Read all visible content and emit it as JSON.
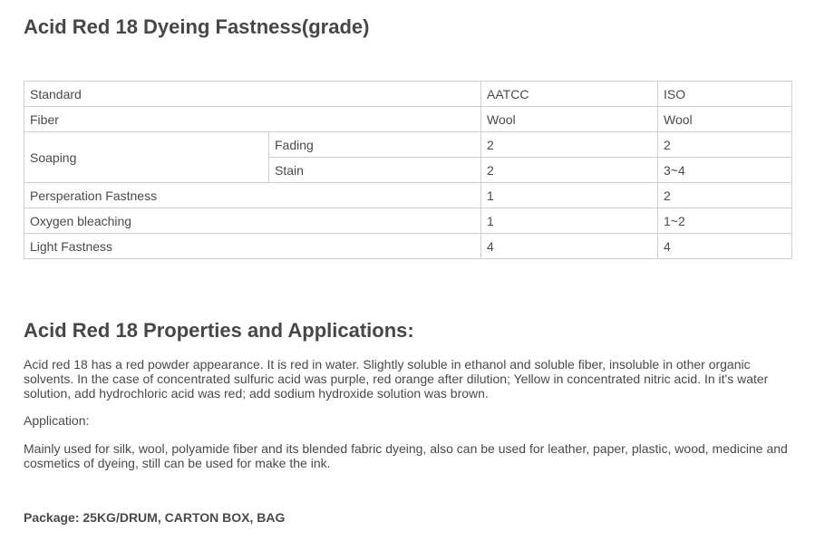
{
  "fastness": {
    "title": "Acid Red 18 Dyeing Fastness(grade)",
    "header": {
      "standard": "Standard",
      "aatcc": "AATCC",
      "iso": "ISO"
    },
    "fiber": {
      "label": "Fiber",
      "aatcc": "Wool",
      "iso": "Wool"
    },
    "soaping": {
      "label": "Soaping",
      "fading": {
        "label": "Fading",
        "aatcc": "2",
        "iso": "2"
      },
      "stain": {
        "label": "Stain",
        "aatcc": "2",
        "iso": "3~4"
      }
    },
    "perspiration": {
      "label": "Persperation Fastness",
      "aatcc": "1",
      "iso": "2"
    },
    "oxygen": {
      "label": "Oxygen bleaching",
      "aatcc": "1",
      "iso": "1~2"
    },
    "light": {
      "label": "Light Fastness",
      "aatcc": "4",
      "iso": "4"
    }
  },
  "properties": {
    "title": "Acid Red 18 Properties and Applications:",
    "description": "Acid red 18 has a red powder appearance. It is red in water. Slightly soluble in ethanol and soluble fiber, insoluble in other organic solvents. In the case of concentrated sulfuric acid was purple, red orange after dilution; Yellow in concentrated nitric acid. In it's water solution, add hydrochloric acid was red; add sodium hydroxide solution was brown.",
    "application_label": "Application:",
    "application_text": "Mainly used for silk, wool, polyamide fiber and its blended fabric dyeing, also can be used for leather, paper, plastic, wood, medicine and cosmetics of dyeing, still can be used for make the ink.",
    "package": "Package: 25KG/DRUM, CARTON BOX, BAG"
  }
}
